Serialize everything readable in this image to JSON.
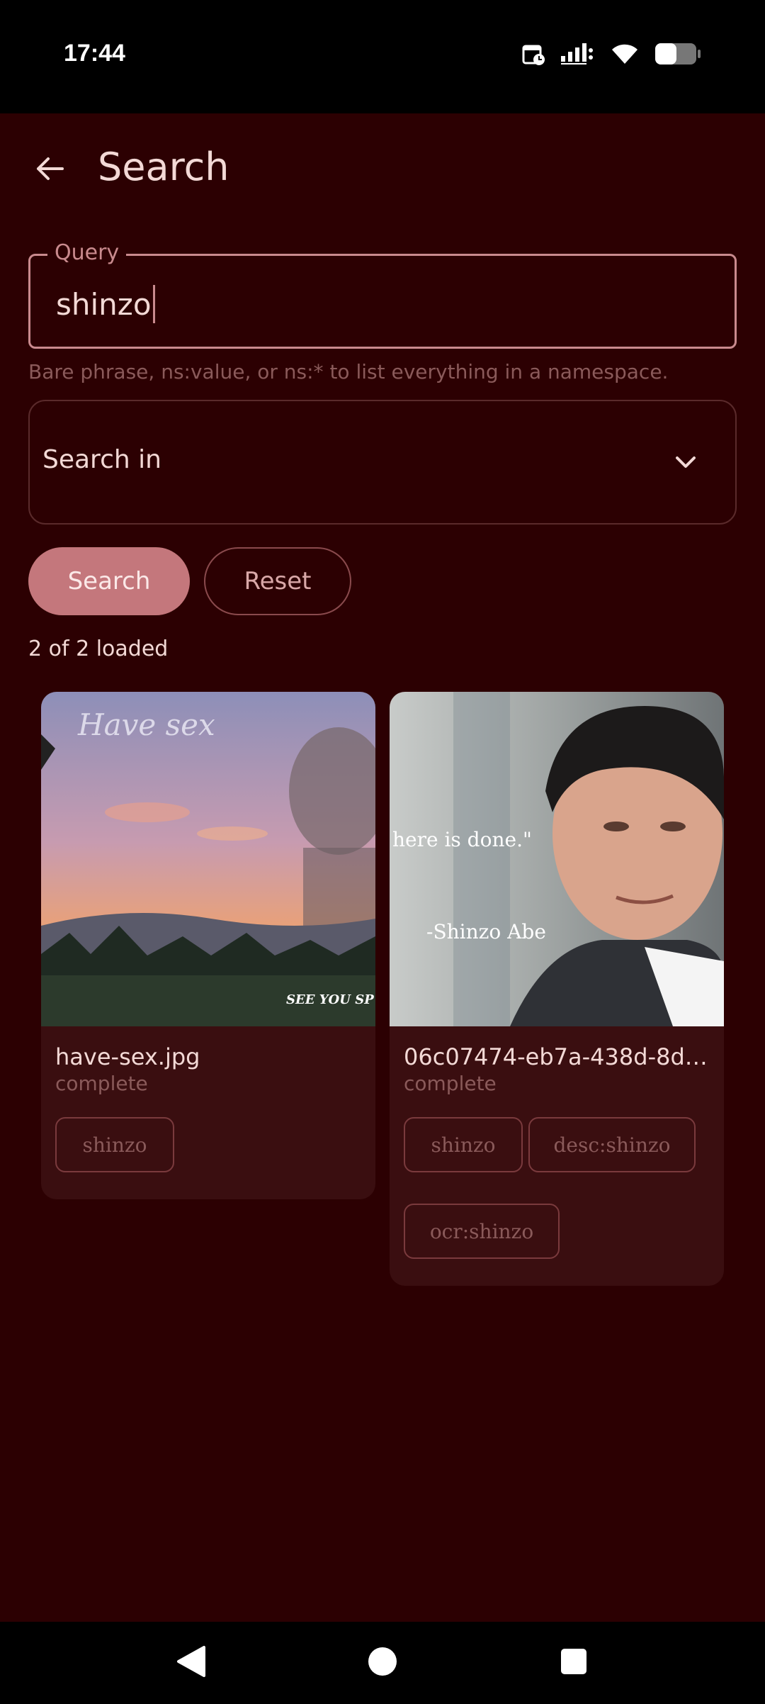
{
  "status_bar": {
    "time": "17:44",
    "icons": [
      "calendar-clock-icon",
      "signal-icon",
      "wifi-icon",
      "battery-icon"
    ]
  },
  "app_bar": {
    "title": "Search",
    "back_icon": "arrow-back-icon"
  },
  "query": {
    "label": "Query",
    "value": "shinzo",
    "helper": "Bare phrase, ns:value, or ns:* to list everything in a namespace."
  },
  "search_in": {
    "label": "Search in",
    "icon": "chevron-down-icon"
  },
  "buttons": {
    "search": "Search",
    "reset": "Reset"
  },
  "results": {
    "count_text": "2 of 2 loaded",
    "items": [
      {
        "name": "have-sex.jpg",
        "status": "complete",
        "image_text": [
          "Have sex",
          "SEE YOU SP"
        ],
        "tags": [
          "shinzo"
        ]
      },
      {
        "name": "06c07474-eb7a-438d-8db...",
        "status": "complete",
        "image_text": [
          "here is done.\"",
          "-Shinzo Abe"
        ],
        "tags": [
          "shinzo",
          "desc:shinzo",
          "ocr:shinzo"
        ]
      }
    ]
  },
  "colors": {
    "background": "#2c0002",
    "accent": "#c4777c",
    "card": "#3a0e10",
    "text": "#f3d9d6",
    "muted": "#8a5a5a"
  }
}
